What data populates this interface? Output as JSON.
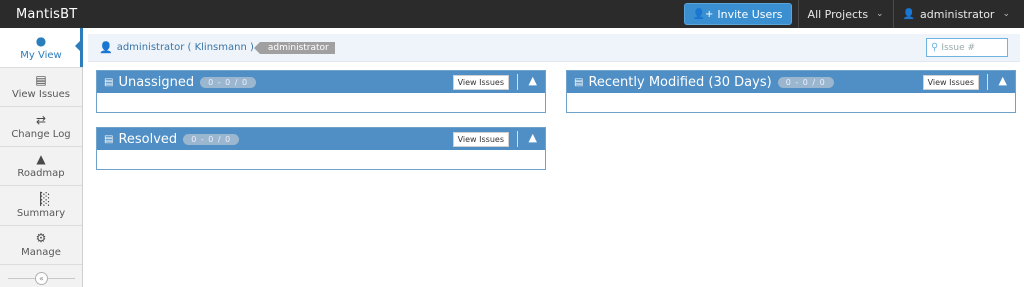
{
  "navbar": {
    "brand": "MantisBT",
    "invite_label": "Invite Users",
    "project_label": "All Projects",
    "user_label": "administrator"
  },
  "sidebar": {
    "items": [
      {
        "label": "My View",
        "icon": "dashboard-icon",
        "active": true
      },
      {
        "label": "View Issues",
        "icon": "list-icon"
      },
      {
        "label": "Change Log",
        "icon": "retweet-icon"
      },
      {
        "label": "Roadmap",
        "icon": "road-icon"
      },
      {
        "label": "Summary",
        "icon": "bar-chart-icon"
      },
      {
        "label": "Manage",
        "icon": "gears-icon"
      }
    ]
  },
  "breadcrumb": {
    "user_link": "administrator ( Klinsmann )",
    "tag": "administrator",
    "search_placeholder": "Issue #"
  },
  "widgets": {
    "unassigned": {
      "title": "Unassigned",
      "count": "0 - 0 / 0",
      "button": "View Issues"
    },
    "recently_modified": {
      "title": "Recently Modified (30 Days)",
      "count": "0 - 0 / 0",
      "button": "View Issues"
    },
    "resolved": {
      "title": "Resolved",
      "count": "0 - 0 / 0",
      "button": "View Issues"
    }
  },
  "colors": {
    "navbar": "#2b2b2b",
    "accent": "#2b7dbc",
    "widget_header": "#4f8fc5",
    "invite_button": "#3a8fd1"
  }
}
